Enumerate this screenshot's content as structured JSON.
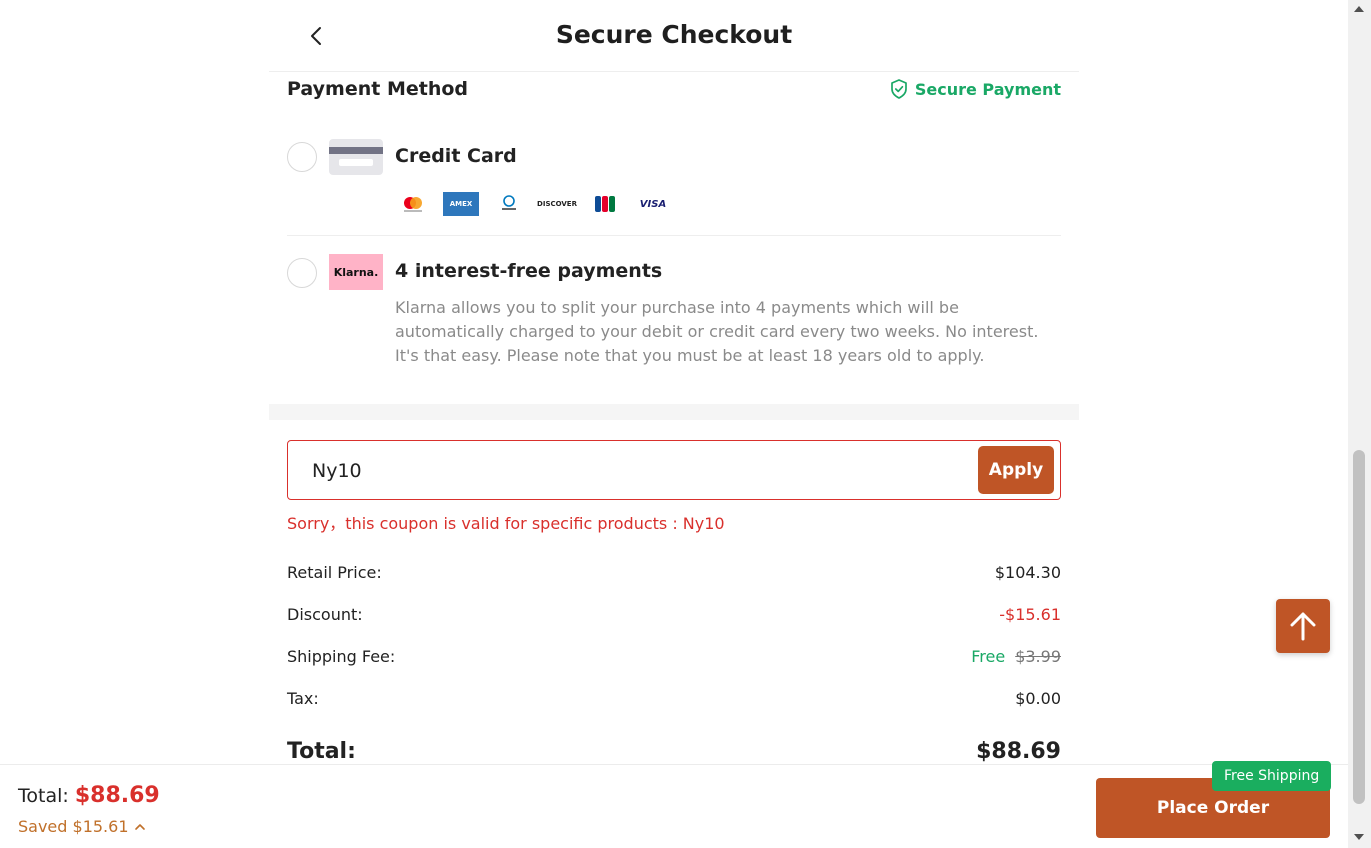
{
  "header": {
    "title": "Secure Checkout"
  },
  "payment": {
    "title": "Payment Method",
    "secure_label": "Secure Payment",
    "methods": [
      {
        "label": "Credit Card",
        "icon": "credit-card-icon",
        "selected": false
      },
      {
        "label": "4 interest-free payments",
        "logo_text": "Klarna.",
        "selected": false,
        "description": "Klarna allows you to split your purchase into 4 payments which will be automatically charged to your debit or credit card every two weeks. No interest. It's that easy. Please note that you must be at least 18 years old to apply."
      }
    ],
    "card_brands": [
      "mastercard",
      "amex",
      "diners-club",
      "discover",
      "jcb",
      "visa"
    ],
    "brand_text": {
      "amex": "AMEX",
      "discover": "DISCOVER",
      "visa": "VISA",
      "jcb": "JCB"
    }
  },
  "coupon": {
    "value": "Ny10",
    "apply_label": "Apply",
    "error": "Sorry，this coupon is valid for specific products : Ny10"
  },
  "summary": {
    "retail_label": "Retail Price:",
    "retail_value": "$104.30",
    "discount_label": "Discount:",
    "discount_value": "-$15.61",
    "shipping_label": "Shipping Fee:",
    "shipping_value": "Free",
    "shipping_original": "$3.99",
    "tax_label": "Tax:",
    "tax_value": "$0.00",
    "total_label": "Total:",
    "total_value": "$88.69"
  },
  "bottom_bar": {
    "total_label": "Total:",
    "total_value": "$88.69",
    "saved_label": "Saved $15.61",
    "place_order_label": "Place Order",
    "free_shipping_badge": "Free Shipping"
  },
  "colors": {
    "accent": "#bf5526",
    "error": "#d9302c",
    "success": "#1aa866",
    "klarna_pink": "#ffb3c7"
  }
}
